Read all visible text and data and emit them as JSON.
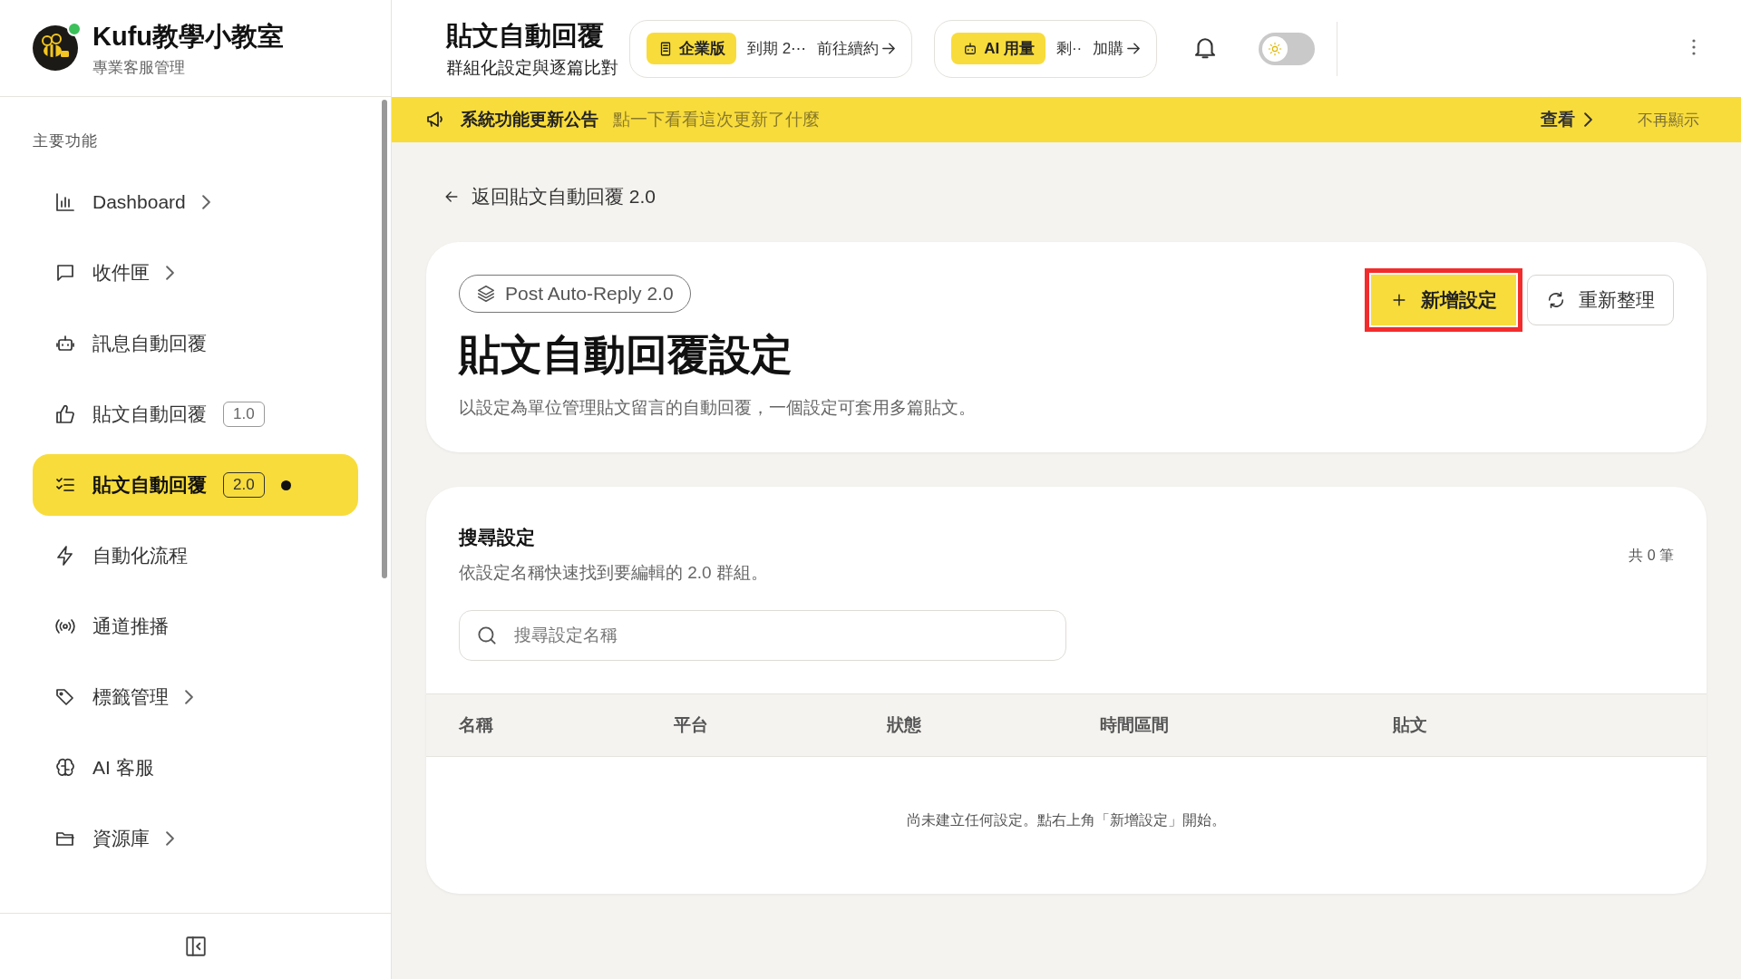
{
  "brand": {
    "name": "Kufu教學小教室",
    "subtitle": "專業客服管理",
    "online": true
  },
  "sidebar": {
    "section": "主要功能",
    "items": [
      {
        "label": "Dashboard",
        "chevron": true,
        "selected": false,
        "dot": false
      },
      {
        "label": "收件匣",
        "chevron": true,
        "selected": false,
        "dot": false
      },
      {
        "label": "訊息自動回覆",
        "chevron": false,
        "selected": false,
        "dot": false
      },
      {
        "label": "貼文自動回覆",
        "badge": "1.0",
        "chevron": false,
        "selected": false,
        "dot": false
      },
      {
        "label": "貼文自動回覆",
        "badge": "2.0",
        "chevron": false,
        "selected": true,
        "dot": true
      },
      {
        "label": "自動化流程",
        "chevron": false,
        "selected": false,
        "dot": false
      },
      {
        "label": "通道推播",
        "chevron": false,
        "selected": false,
        "dot": false
      },
      {
        "label": "標籤管理",
        "chevron": true,
        "selected": false,
        "dot": false
      },
      {
        "label": "AI 客服",
        "chevron": false,
        "selected": false,
        "dot": false
      },
      {
        "label": "資源庫",
        "chevron": true,
        "selected": false,
        "dot": false
      }
    ]
  },
  "header": {
    "title": "貼文自動回覆",
    "subtitle": "群組化設定與逐篇比對",
    "plan": {
      "badge": "企業版",
      "text": "到期 2⋯",
      "link": "前往續約"
    },
    "usage": {
      "badge": "AI 用量",
      "text": "剩··",
      "link": "加購"
    },
    "theme_toggle": {
      "on": false
    }
  },
  "banner": {
    "title": "系統功能更新公告",
    "text": "點一下看看這次更新了什麼",
    "action": "查看",
    "dismiss": "不再顯示"
  },
  "back_link": "返回貼文自動回覆 2.0",
  "page_card": {
    "tag": "Post Auto-Reply 2.0",
    "title": "貼文自動回覆設定",
    "description": "以設定為單位管理貼文留言的自動回覆，一個設定可套用多篇貼文。",
    "buttons": [
      {
        "label": "新增設定",
        "kind": "primary",
        "highlighted": true
      },
      {
        "label": "重新整理",
        "kind": "secondary",
        "highlighted": false
      }
    ]
  },
  "search_card": {
    "title": "搜尋設定",
    "description": "依設定名稱快速找到要編輯的 2.0 群組。",
    "count": "共 0 筆",
    "search": {
      "placeholder": "搜尋設定名稱"
    },
    "table": {
      "columns": [
        "名稱",
        "平台",
        "狀態",
        "時間區間",
        "貼文"
      ],
      "empty_message": "尚未建立任何設定。點右上角「新增設定」開始。"
    }
  }
}
